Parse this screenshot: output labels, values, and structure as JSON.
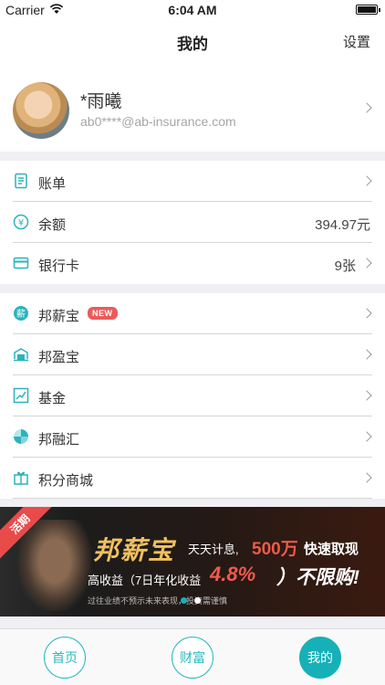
{
  "status_bar": {
    "carrier": "Carrier",
    "time": "6:04 AM"
  },
  "nav": {
    "title": "我的",
    "settings": "设置"
  },
  "profile": {
    "name": "*雨曦",
    "email": "ab0****@ab-insurance.com"
  },
  "account_group": [
    {
      "label": "账单",
      "value": "",
      "icon": "bill-icon"
    },
    {
      "label": "余额",
      "value": "394.97元",
      "icon": "yuan-icon"
    },
    {
      "label": "银行卡",
      "value": "9张",
      "icon": "bank-card-icon"
    }
  ],
  "products_group": [
    {
      "label": "邦薪宝",
      "badge": "NEW",
      "icon": "bangxinbao-icon"
    },
    {
      "label": "邦盈宝",
      "icon": "bangyingbao-icon"
    },
    {
      "label": "基金",
      "icon": "fund-chart-icon"
    },
    {
      "label": "邦融汇",
      "icon": "bangronghui-icon"
    },
    {
      "label": "积分商城",
      "icon": "gift-icon"
    }
  ],
  "banner": {
    "corner_tag": "活期",
    "brand": "邦薪宝",
    "tagline": "天天计息,",
    "highlight": "500万",
    "highlight2": "快速取现",
    "yield_text": "高收益（7日年化收益",
    "rate": "4.8%",
    "rate_suffix": "）不限购!",
    "disclaimer": "过往业绩不预示未来表现，投资需谨慎",
    "active_dot_color": "#16b1b8"
  },
  "tabbar": [
    {
      "label": "首页",
      "active": false
    },
    {
      "label": "财富",
      "active": false
    },
    {
      "label": "我的",
      "active": true
    }
  ],
  "colors": {
    "accent": "#16b1b8",
    "badge": "#ea5b5b",
    "banner_red": "#f05a4a"
  }
}
